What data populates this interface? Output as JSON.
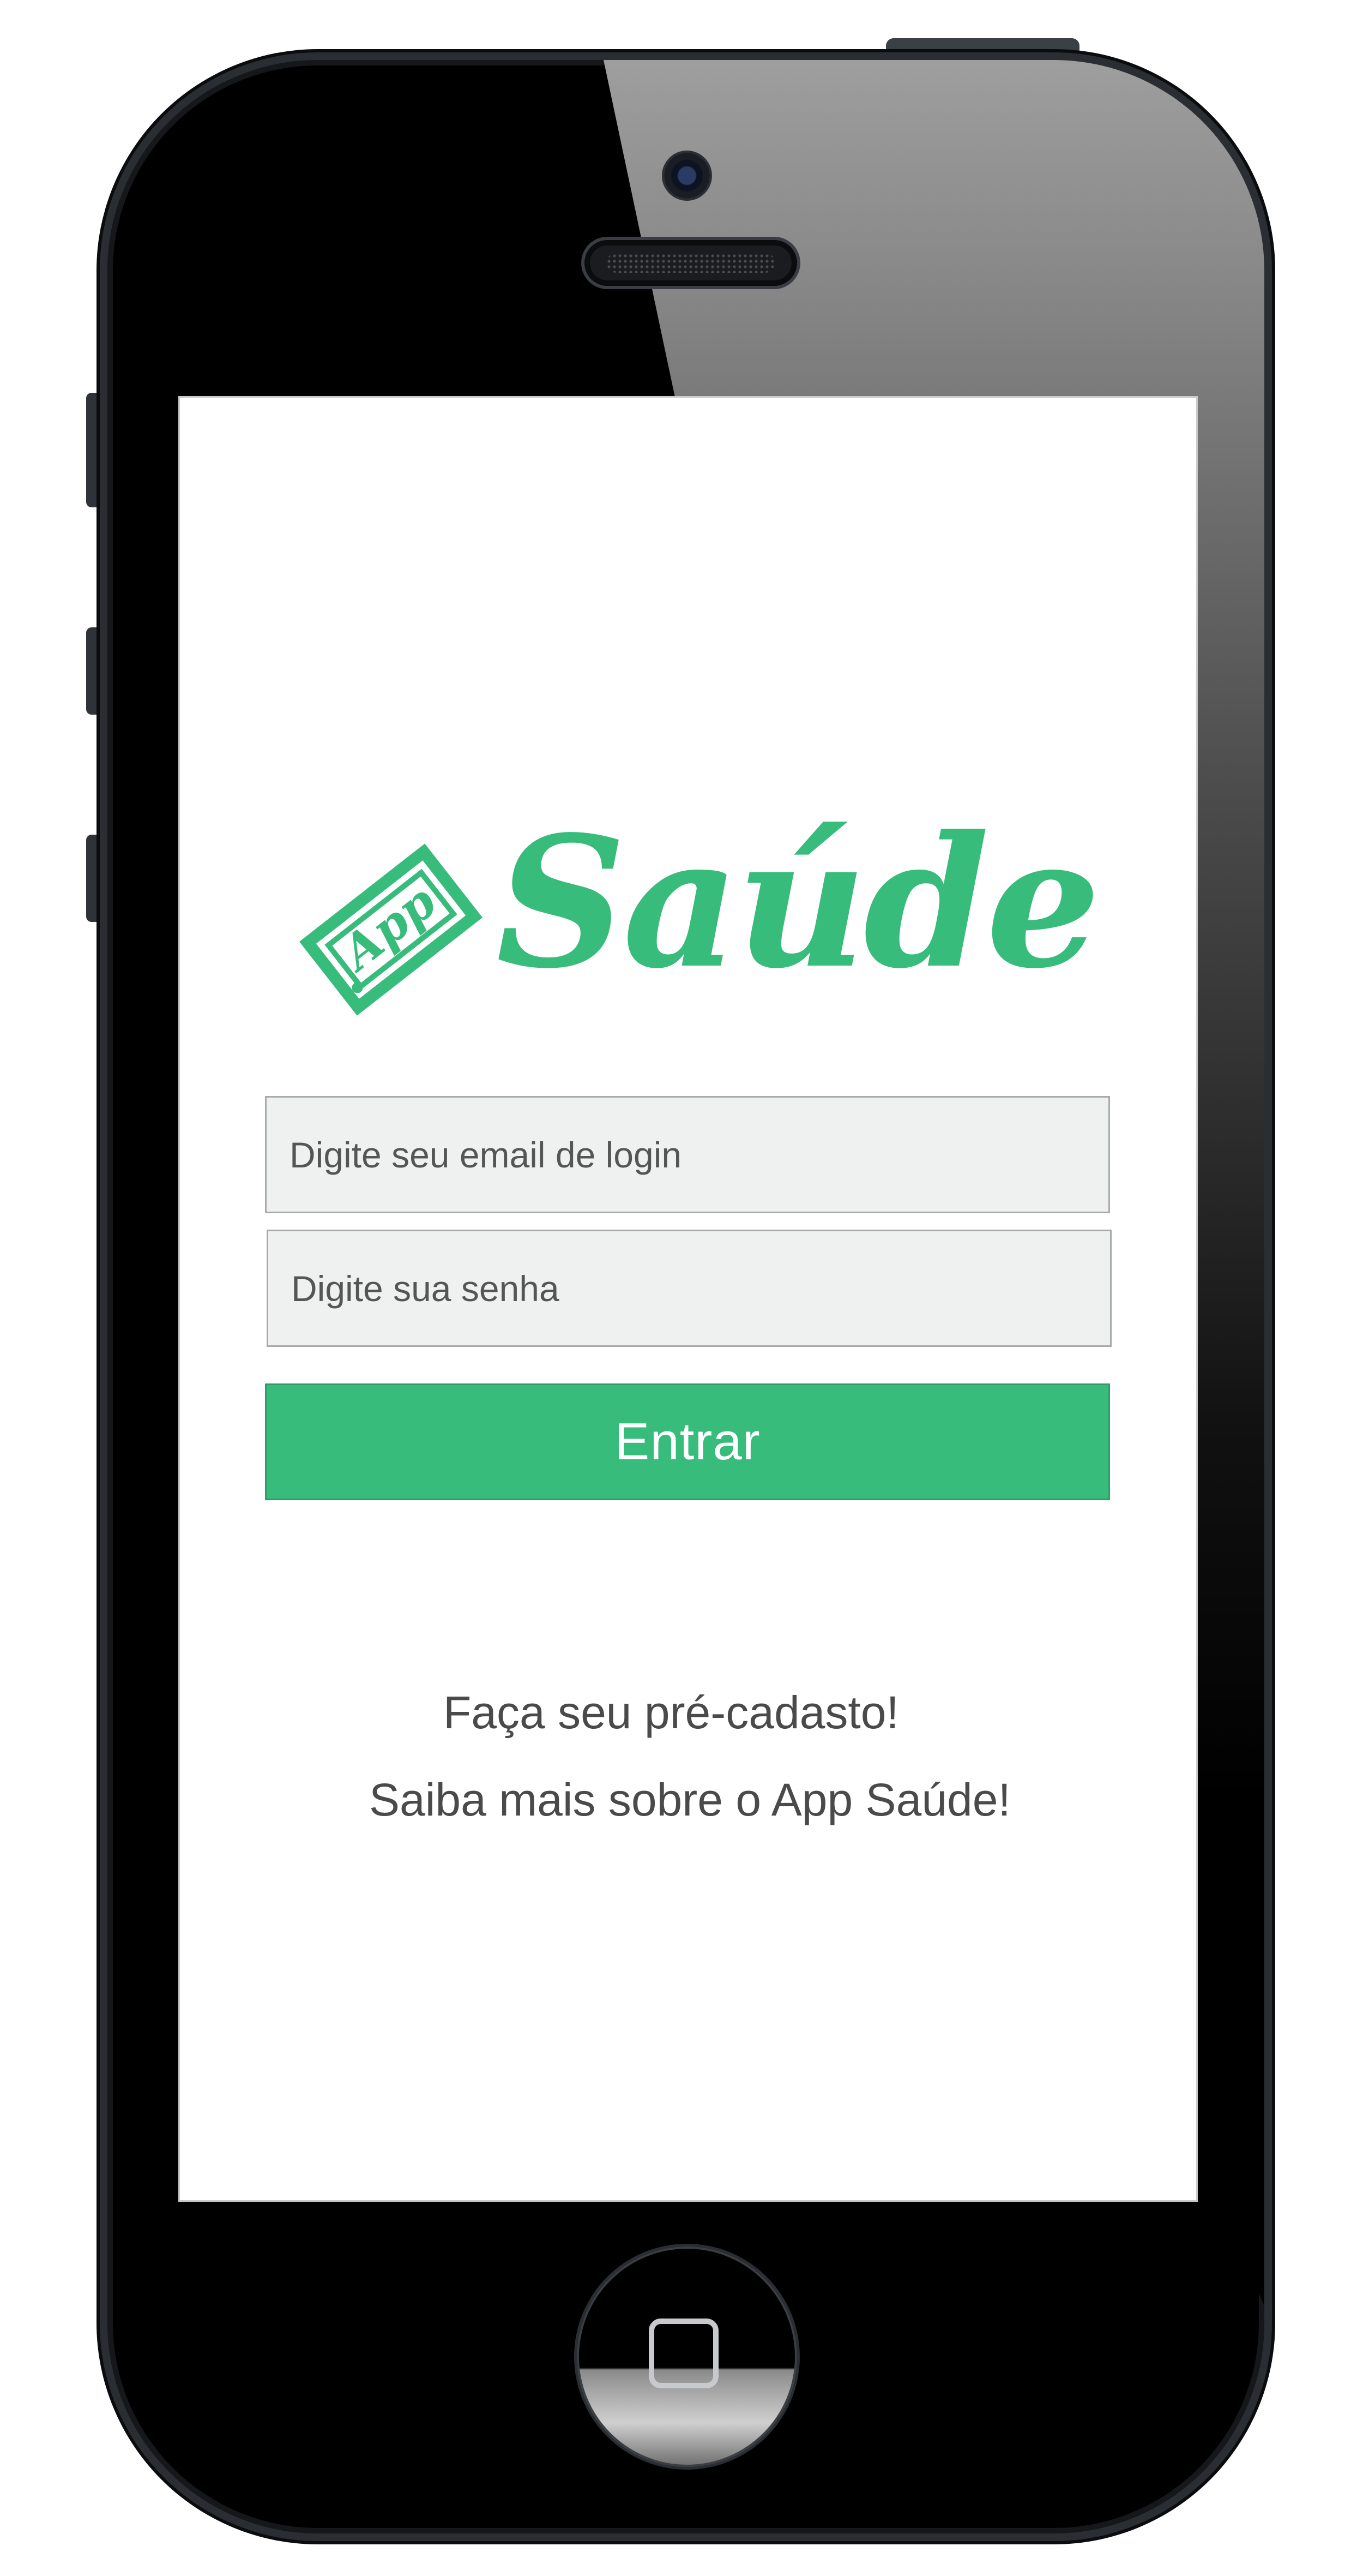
{
  "app": {
    "logo_badge_text": "App",
    "logo_word": "Saúde",
    "brand_color": "#37bc7b"
  },
  "login_form": {
    "email_placeholder": "Digite seu email de login",
    "password_placeholder": "Digite sua senha",
    "submit_label": "Entrar"
  },
  "links": {
    "pre_register": "Faça seu pré-cadasto!",
    "learn_more": "Saiba mais sobre o App Saúde!"
  },
  "device": {
    "icons": [
      "camera-icon",
      "speaker-grille",
      "home-button-icon"
    ]
  }
}
